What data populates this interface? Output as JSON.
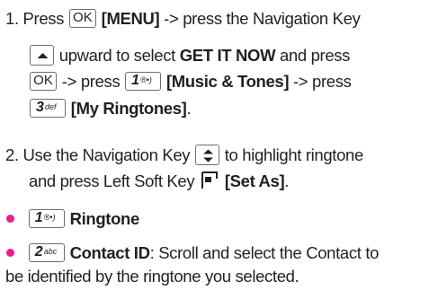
{
  "step1": {
    "num": "1.",
    "press": "Press",
    "key_ok": "OK",
    "menu": "[MENU]",
    "t1": "-> press the Navigation Key",
    "t2": "upward to select",
    "get_it_now": "GET IT NOW",
    "and_press": "and press",
    "t3": "-> press",
    "key_1_digit": "1",
    "key_1_sub": "®•)",
    "music_tones": "[Music & Tones]",
    "t4": "-> press",
    "key_3_digit": "3",
    "key_3_sub": "def",
    "my_ringtones": "[My Ringtones]",
    "period": "."
  },
  "step2": {
    "num": "2.",
    "t1": "Use the Navigation Key",
    "t2": "to highlight ringtone",
    "t3": "and press Left Soft Key",
    "set_as": "[Set As]",
    "period": "."
  },
  "bullets": {
    "ringtone": {
      "key_digit": "1",
      "key_sub": "®•)",
      "label": "Ringtone"
    },
    "contact": {
      "key_digit": "2",
      "key_sub": "abc",
      "label": "Contact ID",
      "text1": ": Scroll and select the Contact to",
      "text2": "be identified by the ringtone you selected."
    }
  },
  "colors": {
    "bullet": "#ed1c8c",
    "text": "#231f20",
    "key_border": "#6d6e71"
  }
}
